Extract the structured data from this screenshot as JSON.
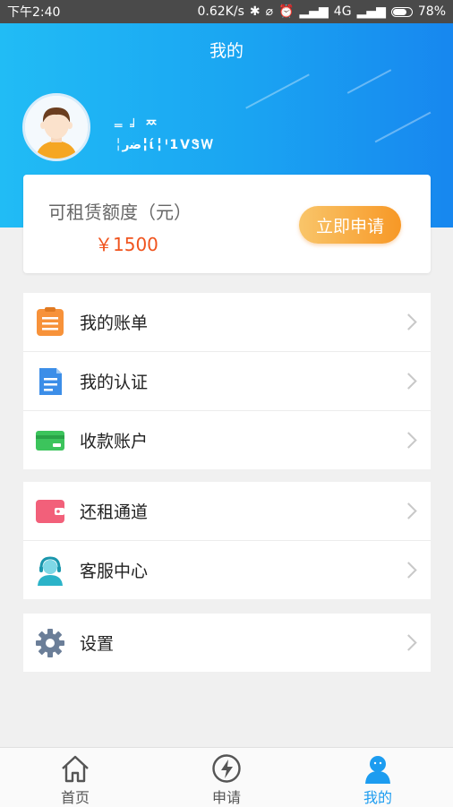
{
  "status_bar": {
    "time": "下午2:40",
    "speed": "0.62K/s",
    "network": "4G",
    "battery": "78%",
    "battery_level": 0.78
  },
  "header": {
    "title": "我的",
    "username": "═ ╛ ᄍ",
    "phone": "╎ﺿﺭ╏ί╏ˡ1ᐯᏕᎳ"
  },
  "quota": {
    "label": "可租赁额度（元）",
    "value": "￥1500",
    "apply_button": "立即申请"
  },
  "menu_groups": [
    [
      {
        "label": "我的账单",
        "icon": "bill-icon"
      },
      {
        "label": "我的认证",
        "icon": "certification-icon"
      },
      {
        "label": "收款账户",
        "icon": "bank-card-icon"
      }
    ],
    [
      {
        "label": "还租通道",
        "icon": "wallet-icon"
      },
      {
        "label": "客服中心",
        "icon": "customer-service-icon"
      }
    ],
    [
      {
        "label": "设置",
        "icon": "gear-icon"
      }
    ]
  ],
  "tabs": [
    {
      "label": "首页",
      "icon": "home-icon",
      "active": false
    },
    {
      "label": "申请",
      "icon": "lightning-icon",
      "active": false
    },
    {
      "label": "我的",
      "icon": "user-icon",
      "active": true
    }
  ],
  "colors": {
    "header_gradient_start": "#21bcf5",
    "header_gradient_end": "#1787ef",
    "accent_orange": "#f79826",
    "quota_red": "#f0541e",
    "tab_active": "#1c9cf0"
  }
}
